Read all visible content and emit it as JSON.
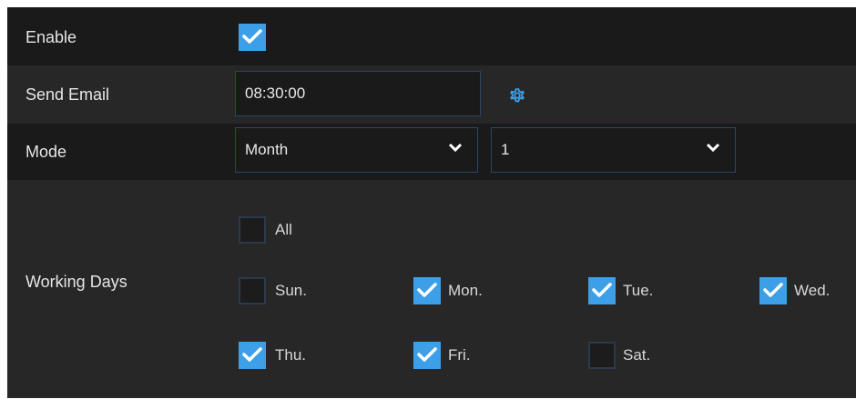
{
  "enable": {
    "label": "Enable",
    "checked": true
  },
  "send_email": {
    "label": "Send Email",
    "time_value": "08:30:00",
    "icon": "gear-icon"
  },
  "mode": {
    "label": "Mode",
    "period_value": "Month",
    "day_value": "1"
  },
  "working_days": {
    "label": "Working Days",
    "all": {
      "label": "All",
      "checked": false
    },
    "days": [
      {
        "label": "Sun.",
        "checked": false
      },
      {
        "label": "Mon.",
        "checked": true
      },
      {
        "label": "Tue.",
        "checked": true
      },
      {
        "label": "Wed.",
        "checked": true
      },
      {
        "label": "Thu.",
        "checked": true
      },
      {
        "label": "Fri.",
        "checked": true
      },
      {
        "label": "Sat.",
        "checked": false
      }
    ]
  },
  "colors": {
    "accent": "#3d9fe8",
    "field_border": "#2a4566"
  }
}
